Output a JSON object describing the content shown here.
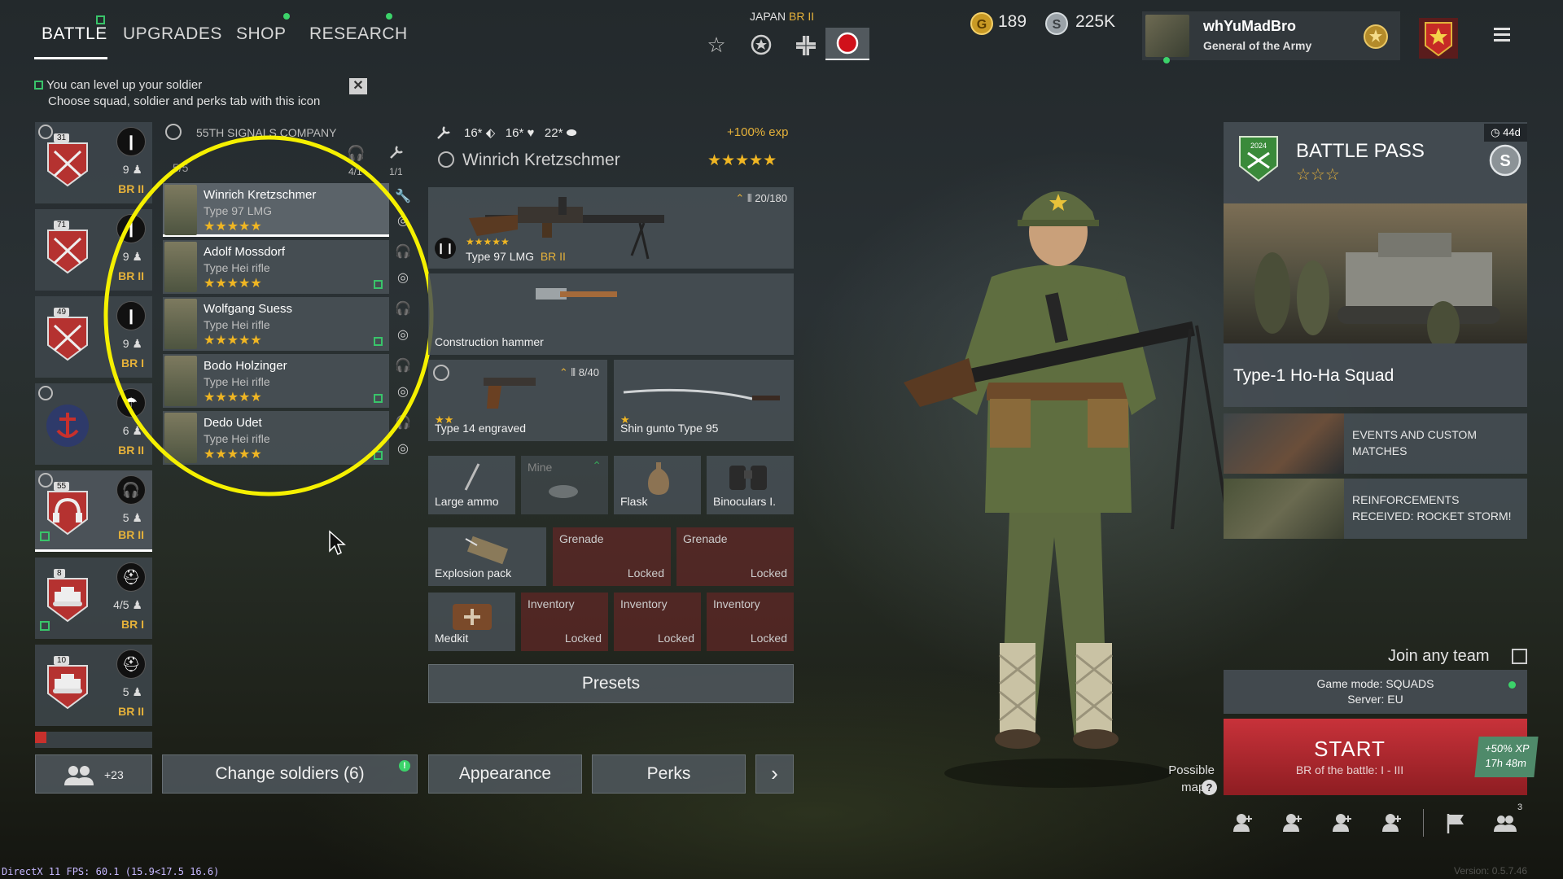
{
  "nav": {
    "tabs": [
      {
        "label": "BATTLE"
      },
      {
        "label": "UPGRADES"
      },
      {
        "label": "SHOP"
      },
      {
        "label": "RESEARCH"
      }
    ]
  },
  "nation": {
    "name": "JAPAN",
    "br": "BR II"
  },
  "currency": {
    "gold": "189",
    "silver": "225K"
  },
  "profile": {
    "name": "whYuMadBro",
    "rank": "General of the Army"
  },
  "hint": {
    "line1": "You can level up your soldier",
    "line2": "Choose squad, soldier and perks tab with this icon"
  },
  "squads": [
    {
      "level": "31",
      "count": "9",
      "br": "BR II"
    },
    {
      "level": "71",
      "count": "9",
      "br": "BR II"
    },
    {
      "level": "49",
      "count": "9",
      "br": "BR I"
    },
    {
      "level": "",
      "count": "6",
      "br": "BR II"
    },
    {
      "level": "55",
      "count": "5",
      "br": "BR II"
    },
    {
      "level": "8",
      "count": "4/5",
      "br": "BR I"
    },
    {
      "level": "10",
      "count": "5",
      "br": "BR II"
    }
  ],
  "company": {
    "name": "55TH SIGNALS COMPANY",
    "slots": "5/5",
    "radio": "4/1",
    "repair": "1/1"
  },
  "soldiers": [
    {
      "name": "Winrich Kretzschmer",
      "weapon": "Type 97 LMG",
      "stars": "★★★★★"
    },
    {
      "name": "Adolf Mossdorf",
      "weapon": "Type Hei rifle",
      "stars": "★★★★★"
    },
    {
      "name": "Wolfgang Suess",
      "weapon": "Type Hei rifle",
      "stars": "★★★★★"
    },
    {
      "name": "Bodo Holzinger",
      "weapon": "Type Hei rifle",
      "stars": "★★★★★"
    },
    {
      "name": "Dedo Udet",
      "weapon": "Type Hei rifle",
      "stars": "★★★★★"
    }
  ],
  "soldier_detail": {
    "stats": {
      "stat1": "16*",
      "stat2": "16*",
      "stat3": "22*"
    },
    "exp_bonus": "+100% exp",
    "name": "Winrich Kretzschmer",
    "stars": "★★★★★"
  },
  "loadout": {
    "primary": {
      "name": "Type 97 LMG",
      "br": "BR II",
      "ammo": "20/180",
      "stars": "★★★★★"
    },
    "melee_tool": {
      "name": "Construction hammer"
    },
    "secondary": {
      "name": "Type 14 engraved",
      "ammo": "8/40",
      "stars": "★★"
    },
    "melee": {
      "name": "Shin gunto Type 95",
      "stars": "★"
    },
    "equipment": [
      {
        "name": "Large ammo"
      },
      {
        "name": "Mine"
      },
      {
        "name": "Flask"
      },
      {
        "name": "Binoculars I."
      }
    ],
    "explosive": {
      "name": "Explosion pack"
    },
    "grenade_slots": [
      {
        "title": "Grenade",
        "state": "Locked"
      },
      {
        "title": "Grenade",
        "state": "Locked"
      }
    ],
    "medkit": {
      "name": "Medkit"
    },
    "inventory_slots": [
      {
        "title": "Inventory",
        "state": "Locked"
      },
      {
        "title": "Inventory",
        "state": "Locked"
      },
      {
        "title": "Inventory",
        "state": "Locked"
      }
    ],
    "presets_label": "Presets"
  },
  "bottom_bar": {
    "reserve_count": "+23",
    "change_soldiers": "Change soldiers (6)",
    "appearance": "Appearance",
    "perks": "Perks",
    "next": "›"
  },
  "battle_pass": {
    "title": "BATTLE PASS",
    "timer": "44d",
    "year": "2024"
  },
  "event": {
    "title": "Type-1 Ho-Ha Squad"
  },
  "news": [
    {
      "text": "EVENTS AND CUSTOM MATCHES"
    },
    {
      "text": "REINFORCEMENTS RECEIVED: ROCKET STORM!"
    }
  ],
  "match": {
    "join_any_team": "Join any team",
    "game_mode": "Game mode: SQUADS",
    "server": "Server: EU",
    "start": "START",
    "br_range": "BR of the battle: I - III",
    "xp_bonus": "+50% XP",
    "xp_timer": "17h 48m",
    "possible_maps": "Possible maps:",
    "party_count": "3"
  },
  "debug": {
    "fps": "DirectX 11 FPS: 60.1 (15.9<17.5 16.6)",
    "version": "Version: 0.5.7.46"
  },
  "colors": {
    "accent_gold": "#e5b13a",
    "start_red": "#b8232c",
    "green": "#3cd36a",
    "highlight": "#f5f000"
  }
}
